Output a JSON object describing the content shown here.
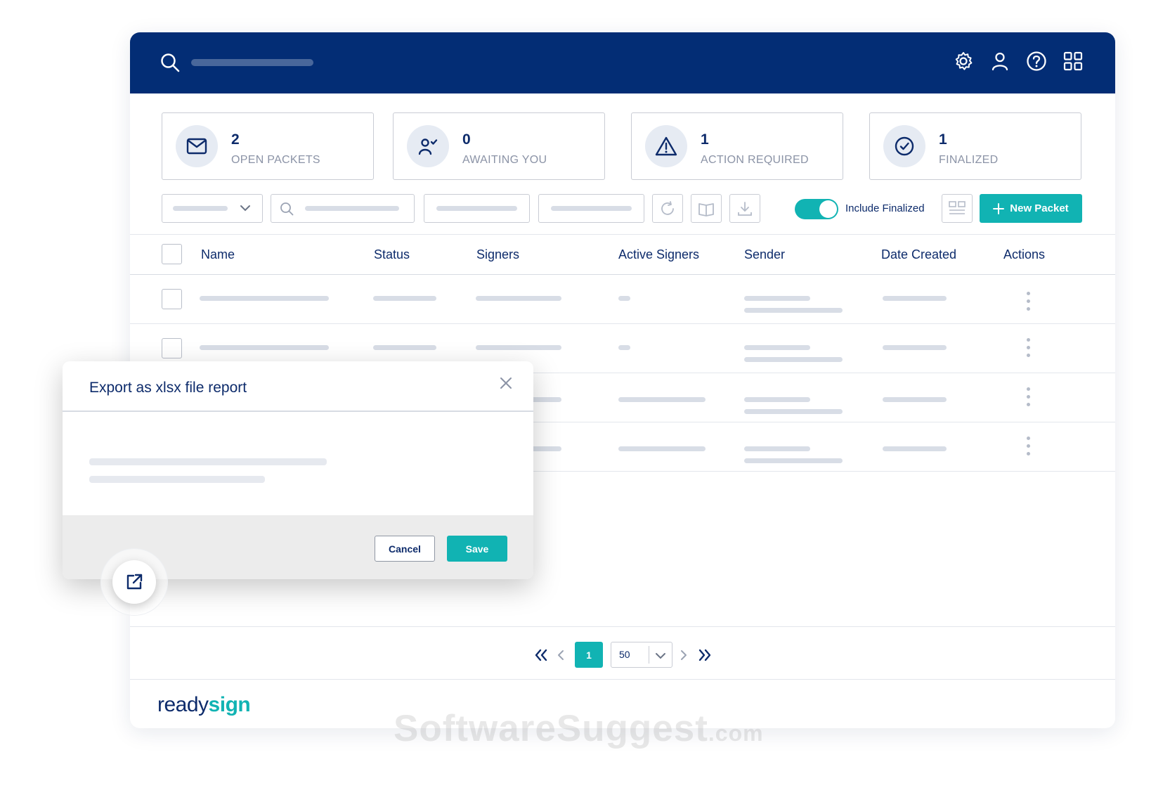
{
  "header": {
    "icons": [
      "search-icon",
      "gear-icon",
      "user-icon",
      "help-icon",
      "apps-grid-icon"
    ]
  },
  "stats": [
    {
      "count": "2",
      "label": "OPEN PACKETS",
      "icon": "mail-icon"
    },
    {
      "count": "0",
      "label": "AWAITING YOU",
      "icon": "user-check-icon"
    },
    {
      "count": "1",
      "label": "ACTION REQUIRED",
      "icon": "warning-icon"
    },
    {
      "count": "1",
      "label": "FINALIZED",
      "icon": "check-circle-icon"
    }
  ],
  "toolbar": {
    "toggle_label": "Include Finalized",
    "toggle_on": true,
    "new_packet_label": "New Packet",
    "icons": [
      "refresh-icon",
      "book-icon",
      "download-icon",
      "layout-icon",
      "plus-icon"
    ]
  },
  "table": {
    "columns": [
      "Name",
      "Status",
      "Signers",
      "Active Signers",
      "Sender",
      "Date Created",
      "Actions"
    ]
  },
  "pagination": {
    "current_page": "1",
    "per_page": "50"
  },
  "dialog": {
    "title": "Export as xlsx file report",
    "cancel_label": "Cancel",
    "save_label": "Save"
  },
  "brand": {
    "logo_part1": "ready",
    "logo_part2": "sign"
  },
  "watermark": {
    "main": "SoftwareSuggest",
    "suffix": ".com"
  },
  "colors": {
    "header_bg": "#032d75",
    "accent": "#11b3b3",
    "text": "#0d2b6b"
  }
}
